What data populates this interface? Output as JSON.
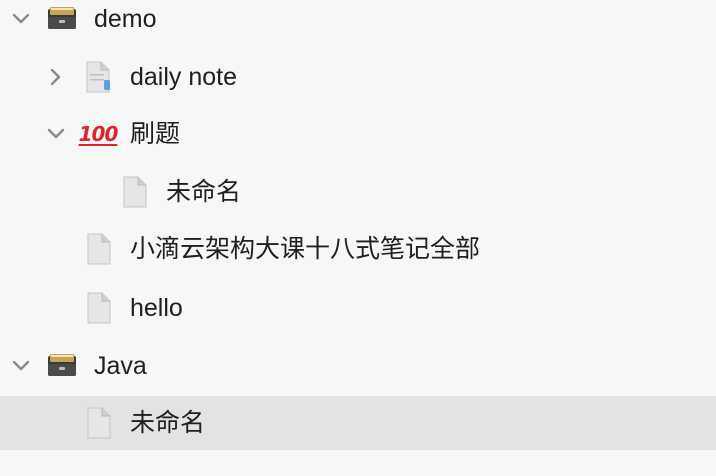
{
  "tree": {
    "demo": {
      "label": "demo",
      "icon": "notebook-box-icon",
      "children": {
        "daily_note": {
          "label": "daily note",
          "icon": "document-stack-icon"
        },
        "shuati": {
          "label": "刷题",
          "icon": "hundred-points-icon",
          "icon_glyph": "100",
          "children": {
            "untitled": {
              "label": "未命名",
              "icon": "document-icon"
            }
          }
        },
        "xiaodi": {
          "label": "小滴云架构大课十八式笔记全部",
          "icon": "document-icon"
        },
        "hello": {
          "label": "hello",
          "icon": "document-icon"
        }
      }
    },
    "java": {
      "label": "Java",
      "icon": "notebook-box-icon",
      "children": {
        "untitled": {
          "label": "未命名",
          "icon": "document-icon"
        }
      }
    }
  },
  "colors": {
    "background": "#f7f7f7",
    "selected_row": "#e3e3e3",
    "text": "#1f1f1f",
    "chevron": "#8a8a8a",
    "hundred_red": "#e0242b"
  }
}
